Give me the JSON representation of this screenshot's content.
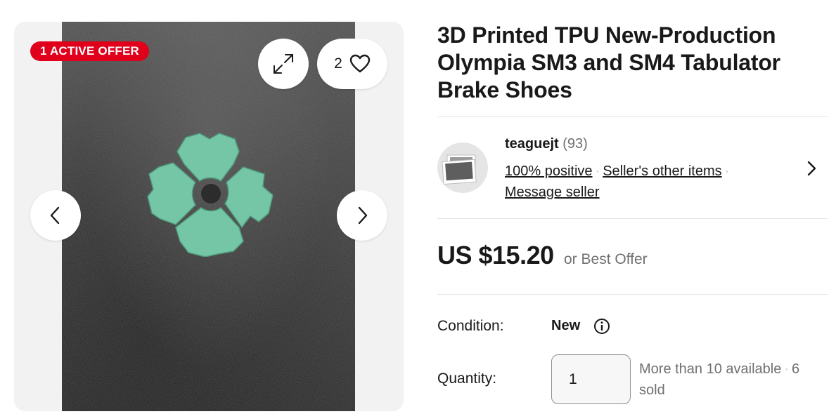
{
  "gallery": {
    "offer_badge": "1 ACTIVE OFFER",
    "watch_count": "2",
    "icons": [
      "expand-icon",
      "heart-icon",
      "chevron-left-icon",
      "chevron-right-icon"
    ]
  },
  "listing": {
    "title": "3D Printed TPU New-Production Olympia SM3 and SM4 Tabulator Brake Shoes",
    "price": "US $15.20",
    "price_suffix": "or Best Offer"
  },
  "seller": {
    "name": "teaguejt",
    "feedback_count": "(93)",
    "positive": "100% positive",
    "other_items": "Seller's other items",
    "message": "Message seller"
  },
  "condition": {
    "label": "Condition:",
    "value": "New"
  },
  "quantity": {
    "label": "Quantity:",
    "value": "1",
    "availability": "More than 10 available",
    "sold": "6 sold"
  },
  "colors": {
    "badge_red": "#e0001b",
    "part_green": "#74c6a6",
    "text": "#191919",
    "muted": "#707070"
  }
}
